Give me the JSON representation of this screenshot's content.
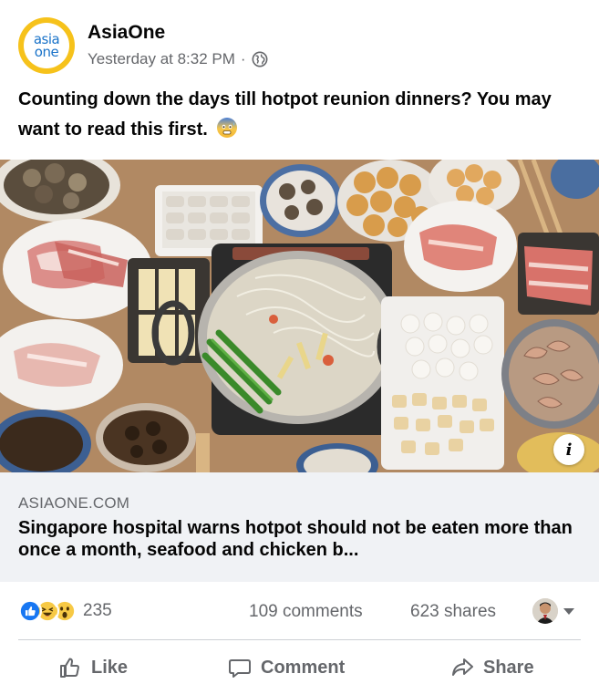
{
  "post": {
    "page_name": "AsiaOne",
    "avatar_text_top": "asia",
    "avatar_text_bottom": "one",
    "timestamp": "Yesterday at 8:32 PM",
    "separator": "·",
    "privacy_icon": "globe-icon",
    "caption": "Counting down the days till hotpot reunion dinners? You may want to read this first.",
    "caption_emoji": "anxious-face-emoji"
  },
  "link_preview": {
    "image_subject": "hotpot-spread-photo",
    "info_label": "i",
    "domain": "ASIAONE.COM",
    "headline": "Singapore hospital warns hotpot should not be eaten more than once a month, seafood and chicken b..."
  },
  "engagement": {
    "reaction_icons": [
      "like-icon",
      "haha-icon",
      "wow-icon"
    ],
    "reaction_count": "235",
    "comments": "109 comments",
    "shares": "623 shares"
  },
  "actions": {
    "like": "Like",
    "comment": "Comment",
    "share": "Share"
  },
  "colors": {
    "brand_yellow": "#f6c21b",
    "brand_blue": "#1a73c9",
    "secondary_text": "#65676b",
    "link_meta_bg": "#f0f2f5",
    "like_blue": "#1877f2"
  }
}
